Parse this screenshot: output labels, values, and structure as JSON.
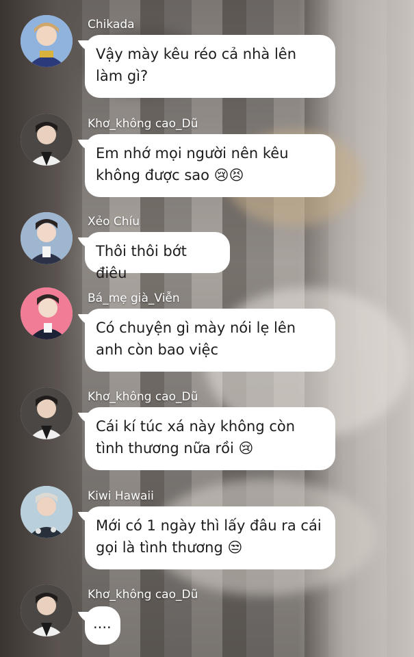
{
  "messages": [
    {
      "sender": "Chikada",
      "text": "Vậy mày kêu réo cả nhà lên làm gì?",
      "avatar_icon": "avatar-chikada-icon",
      "avatar_color": "#2a3a7a"
    },
    {
      "sender": "Khơ_không cao_Dũ",
      "text": "Em nhớ mọi người nên kêu không được sao 😢😣",
      "avatar_icon": "avatar-kho-icon",
      "avatar_color": "#3a3836"
    },
    {
      "sender": "Xẻo Chíu",
      "text": "Thôi thôi bớt điêu",
      "avatar_icon": "avatar-xeo-chiu-icon",
      "avatar_color": "#2b3146"
    },
    {
      "sender": "Bá_mẹ già_Viễn",
      "text": "Có chuyện gì mày nói lẹ lên anh còn bao việc",
      "avatar_icon": "avatar-ba-me-gia-icon",
      "avatar_color": "#e86b86"
    },
    {
      "sender": "Khơ_không cao_Dũ",
      "text": "Cái kí túc xá này không còn tình thương nữa rồi 😢",
      "avatar_icon": "avatar-kho-icon",
      "avatar_color": "#3a3836"
    },
    {
      "sender": "Kiwi Hawaii",
      "text": "Mới có 1 ngày thì lấy đâu ra cái gọi là tình thương 😒",
      "avatar_icon": "avatar-kiwi-icon",
      "avatar_color": "#a9c4d6"
    },
    {
      "sender": "Khơ_không cao_Dũ",
      "text": "....",
      "avatar_icon": "avatar-kho-icon",
      "avatar_color": "#3a3836"
    }
  ]
}
